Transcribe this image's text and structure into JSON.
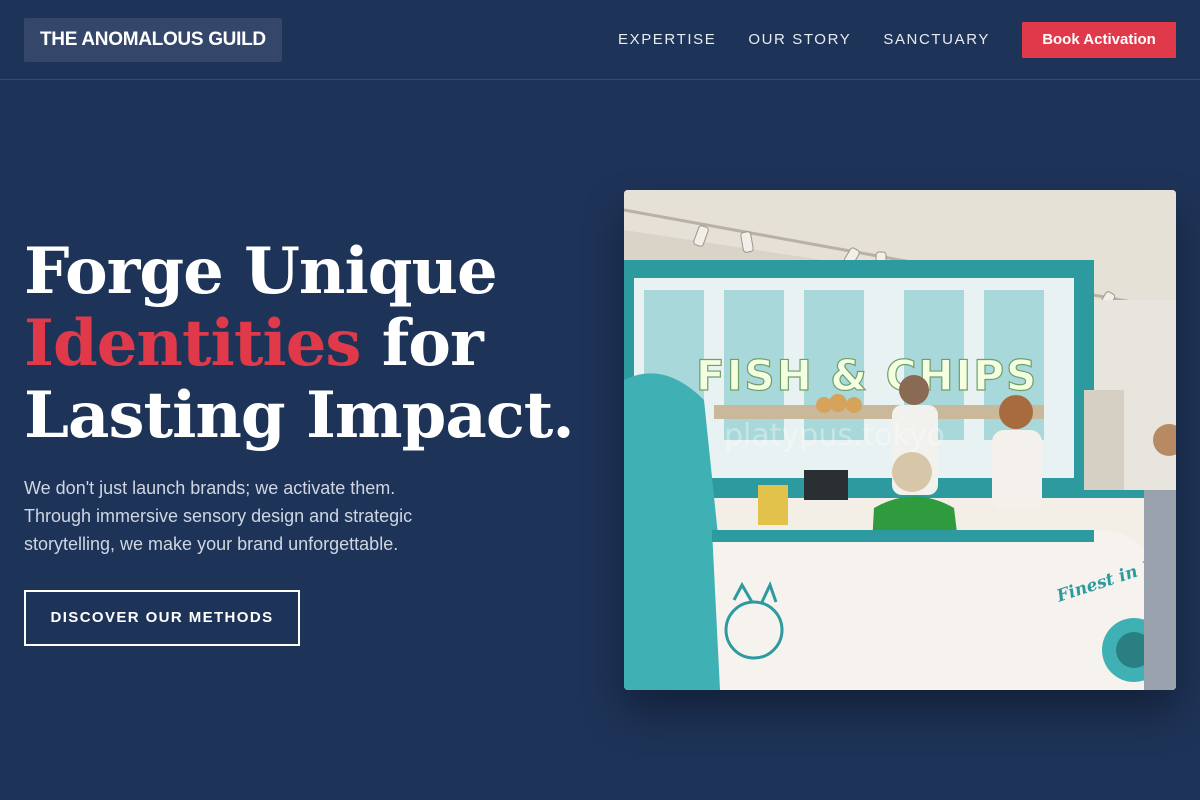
{
  "header": {
    "logo": "THE ANOMALOUS GUILD",
    "nav": [
      "EXPERTISE",
      "OUR STORY",
      "SANCTUARY"
    ],
    "cta_label": "Book Activation"
  },
  "hero": {
    "headline_line1": "Forge Unique",
    "headline_accent": "Identities",
    "headline_line2_rest": " for",
    "headline_line3": "Lasting Impact.",
    "subcopy": "We don't just launch brands; we activate them. Through immersive sensory design and strategic storytelling, we make your brand unforgettable.",
    "button_label": "DISCOVER OUR METHODS"
  },
  "photo": {
    "sign_text": "FISH & CHIPS",
    "van_text": "Finest in London!",
    "watermark": "platypus.tokyo"
  },
  "colors": {
    "background": "#1e3358",
    "accent": "#e03a4a",
    "logo_bg": "#34476b"
  }
}
